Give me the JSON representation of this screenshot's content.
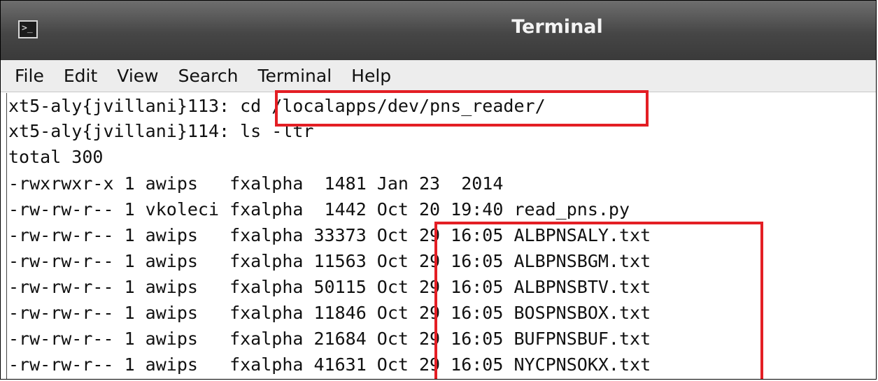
{
  "window": {
    "title": "Terminal",
    "icon": "terminal-icon"
  },
  "menu": [
    "File",
    "Edit",
    "View",
    "Search",
    "Terminal",
    "Help"
  ],
  "terminal": {
    "lines": [
      "xt5-aly{jvillani}113: cd /localapps/dev/pns_reader/",
      "xt5-aly{jvillani}114: ls -ltr",
      "total 300",
      "-rwxrwxr-x 1 awips   fxalpha  1481 Jan 23  2014",
      "-rw-rw-r-- 1 vkoleci fxalpha  1442 Oct 20 19:40 read_pns.py",
      "-rw-rw-r-- 1 awips   fxalpha 33373 Oct 29 16:05 ALBPNSALY.txt",
      "-rw-rw-r-- 1 awips   fxalpha 11563 Oct 29 16:05 ALBPNSBGM.txt",
      "-rw-rw-r-- 1 awips   fxalpha 50115 Oct 29 16:05 ALBPNSBTV.txt",
      "-rw-rw-r-- 1 awips   fxalpha 11846 Oct 29 16:05 BOSPNSBOX.txt",
      "-rw-rw-r-- 1 awips   fxalpha 21684 Oct 29 16:05 BUFPNSBUF.txt",
      "-rw-rw-r-- 1 awips   fxalpha 41631 Oct 29 16:05 NYCPNSOKX.txt"
    ]
  },
  "highlight_color": "#e31e24"
}
